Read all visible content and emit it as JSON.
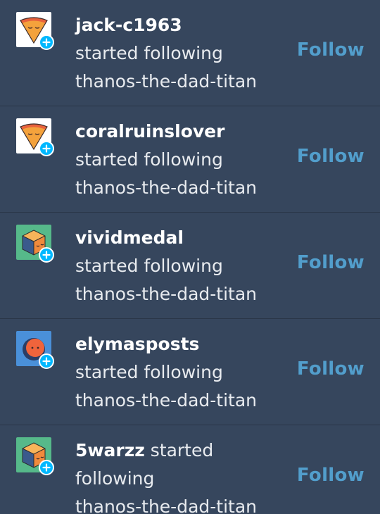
{
  "activity": [
    {
      "username": "jack-c1963",
      "action": "started following",
      "target": "thanos-the-dad-titan",
      "follow_label": "Follow",
      "avatar_icon": "pizza-slice-icon",
      "layout": "separate"
    },
    {
      "username": "coralruinslover",
      "action": "started following",
      "target": "thanos-the-dad-titan",
      "follow_label": "Follow",
      "avatar_icon": "pizza-slice-icon",
      "layout": "separate"
    },
    {
      "username": "vividmedal",
      "action": "started following",
      "target": "thanos-the-dad-titan",
      "follow_label": "Follow",
      "avatar_icon": "cube-face-icon",
      "layout": "separate"
    },
    {
      "username": "elymasposts",
      "action": "started following",
      "target": "thanos-the-dad-titan",
      "follow_label": "Follow",
      "avatar_icon": "moon-face-icon",
      "layout": "separate"
    },
    {
      "username": "5warzz",
      "action_part1": "started",
      "action_part2": "following",
      "target": "thanos-the-dad-titan",
      "follow_label": "Follow",
      "avatar_icon": "cube-face-icon",
      "layout": "inline"
    }
  ],
  "colors": {
    "background": "#36465d",
    "link": "#529ecc",
    "badge": "#00b8ff"
  }
}
